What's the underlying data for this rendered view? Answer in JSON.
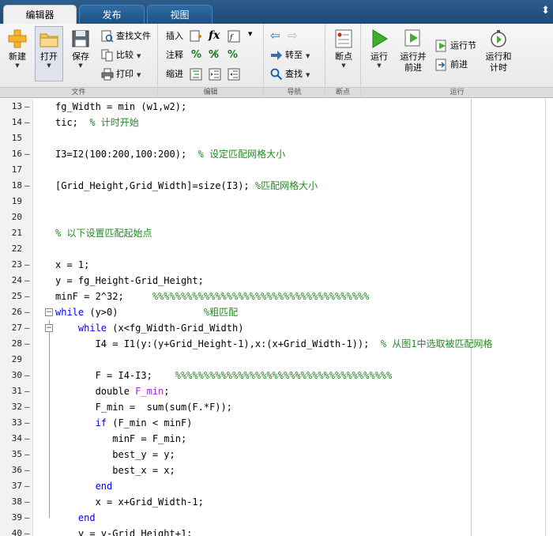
{
  "colors": {
    "keyword": "#0000ff",
    "comment": "#228b22",
    "string": "#a020f0",
    "tabbar": "#1e4a76"
  },
  "tabs": [
    {
      "label": "编辑器",
      "active": true
    },
    {
      "label": "发布"
    },
    {
      "label": "视图"
    }
  ],
  "tab_icon": "pin-icon",
  "ribbon": {
    "file": {
      "label": "文件",
      "new": "新建",
      "open": "打开",
      "save": "保存",
      "find_files": "查找文件",
      "compare": "比较",
      "print": "打印"
    },
    "edit": {
      "label": "编辑",
      "insert": "插入",
      "fx": "fx",
      "comment": "注释",
      "indent": "缩进"
    },
    "nav": {
      "label": "导航",
      "goto": "转至",
      "find": "查找"
    },
    "breakpoints": {
      "label": "断点",
      "bp": "断点"
    },
    "run": {
      "label": "运行",
      "run": "运行",
      "run_adv_1": "运行并",
      "run_adv_2": "前进",
      "run_section": "运行节",
      "advance": "前进",
      "run_time_1": "运行和",
      "run_time_2": "计时"
    }
  },
  "code_lines": [
    {
      "n": "13",
      "m": "–",
      "segs": [
        {
          "t": "    fg_Width = min (w1,w2);",
          "c": ""
        }
      ]
    },
    {
      "n": "14",
      "m": "–",
      "segs": [
        {
          "t": "    tic;  ",
          "c": ""
        },
        {
          "t": "% 计时开始",
          "c": "cm"
        }
      ]
    },
    {
      "n": "15",
      "m": "",
      "segs": []
    },
    {
      "n": "16",
      "m": "–",
      "segs": [
        {
          "t": "    I3=I2(100:200,100:200);  ",
          "c": ""
        },
        {
          "t": "% 设定匹配网格大小",
          "c": "cm"
        }
      ]
    },
    {
      "n": "17",
      "m": "",
      "segs": []
    },
    {
      "n": "18",
      "m": "–",
      "segs": [
        {
          "t": "    [Grid_Height,Grid_Width]=size(I3); ",
          "c": ""
        },
        {
          "t": "%匹配网格大小",
          "c": "cm"
        }
      ]
    },
    {
      "n": "19",
      "m": "",
      "segs": []
    },
    {
      "n": "20",
      "m": "",
      "segs": []
    },
    {
      "n": "21",
      "m": "",
      "segs": [
        {
          "t": "    ",
          "c": ""
        },
        {
          "t": "% 以下设置匹配起始点",
          "c": "cm"
        }
      ]
    },
    {
      "n": "22",
      "m": "",
      "segs": []
    },
    {
      "n": "23",
      "m": "–",
      "segs": [
        {
          "t": "    x = 1;",
          "c": ""
        }
      ]
    },
    {
      "n": "24",
      "m": "–",
      "segs": [
        {
          "t": "    y = fg_Height-Grid_Height;",
          "c": ""
        }
      ]
    },
    {
      "n": "25",
      "m": "–",
      "segs": [
        {
          "t": "    minF = 2^32;     ",
          "c": ""
        },
        {
          "t": "%%%%%%%%%%%%%%%%%%%%%%%%%%%%%%%%%%%%%%",
          "c": "cm"
        }
      ]
    },
    {
      "n": "26",
      "m": "–",
      "segs": [
        {
          "t": "    ",
          "c": ""
        },
        {
          "t": "while",
          "c": "kw"
        },
        {
          "t": " (y>0)               ",
          "c": ""
        },
        {
          "t": "%粗匹配",
          "c": "cm"
        }
      ]
    },
    {
      "n": "27",
      "m": "–",
      "segs": [
        {
          "t": "        ",
          "c": ""
        },
        {
          "t": "while",
          "c": "kw"
        },
        {
          "t": " (x<fg_Width-Grid_Width)",
          "c": ""
        }
      ]
    },
    {
      "n": "28",
      "m": "–",
      "segs": [
        {
          "t": "           I4 = I1(y:(y+Grid_Height-1),x:(x+Grid_Width-1));  ",
          "c": ""
        },
        {
          "t": "% 从图1中选取被匹配网格",
          "c": "cm"
        }
      ]
    },
    {
      "n": "29",
      "m": "",
      "segs": []
    },
    {
      "n": "30",
      "m": "–",
      "segs": [
        {
          "t": "           F = I4-I3;    ",
          "c": ""
        },
        {
          "t": "%%%%%%%%%%%%%%%%%%%%%%%%%%%%%%%%%%%%%%",
          "c": "cm"
        }
      ]
    },
    {
      "n": "31",
      "m": "–",
      "segs": [
        {
          "t": "           double ",
          "c": ""
        },
        {
          "t": "F_min",
          "c": "st"
        },
        {
          "t": ";",
          "c": ""
        }
      ]
    },
    {
      "n": "32",
      "m": "–",
      "segs": [
        {
          "t": "           F_min =  sum(sum(F.*F));",
          "c": ""
        }
      ]
    },
    {
      "n": "33",
      "m": "–",
      "segs": [
        {
          "t": "           ",
          "c": ""
        },
        {
          "t": "if",
          "c": "kw"
        },
        {
          "t": " (F_min < minF)",
          "c": ""
        }
      ]
    },
    {
      "n": "34",
      "m": "–",
      "segs": [
        {
          "t": "              minF = F_min;",
          "c": ""
        }
      ]
    },
    {
      "n": "35",
      "m": "–",
      "segs": [
        {
          "t": "              best_y = y;",
          "c": ""
        }
      ]
    },
    {
      "n": "36",
      "m": "–",
      "segs": [
        {
          "t": "              best_x = x;",
          "c": ""
        }
      ]
    },
    {
      "n": "37",
      "m": "–",
      "segs": [
        {
          "t": "           ",
          "c": ""
        },
        {
          "t": "end",
          "c": "kw"
        }
      ]
    },
    {
      "n": "38",
      "m": "–",
      "segs": [
        {
          "t": "           x = x+Grid_Width-1;",
          "c": ""
        }
      ]
    },
    {
      "n": "39",
      "m": "–",
      "segs": [
        {
          "t": "        ",
          "c": ""
        },
        {
          "t": "end",
          "c": "kw"
        }
      ]
    },
    {
      "n": "40",
      "m": "–",
      "segs": [
        {
          "t": "        y = y-Grid_Height+1;",
          "c": ""
        }
      ]
    }
  ]
}
